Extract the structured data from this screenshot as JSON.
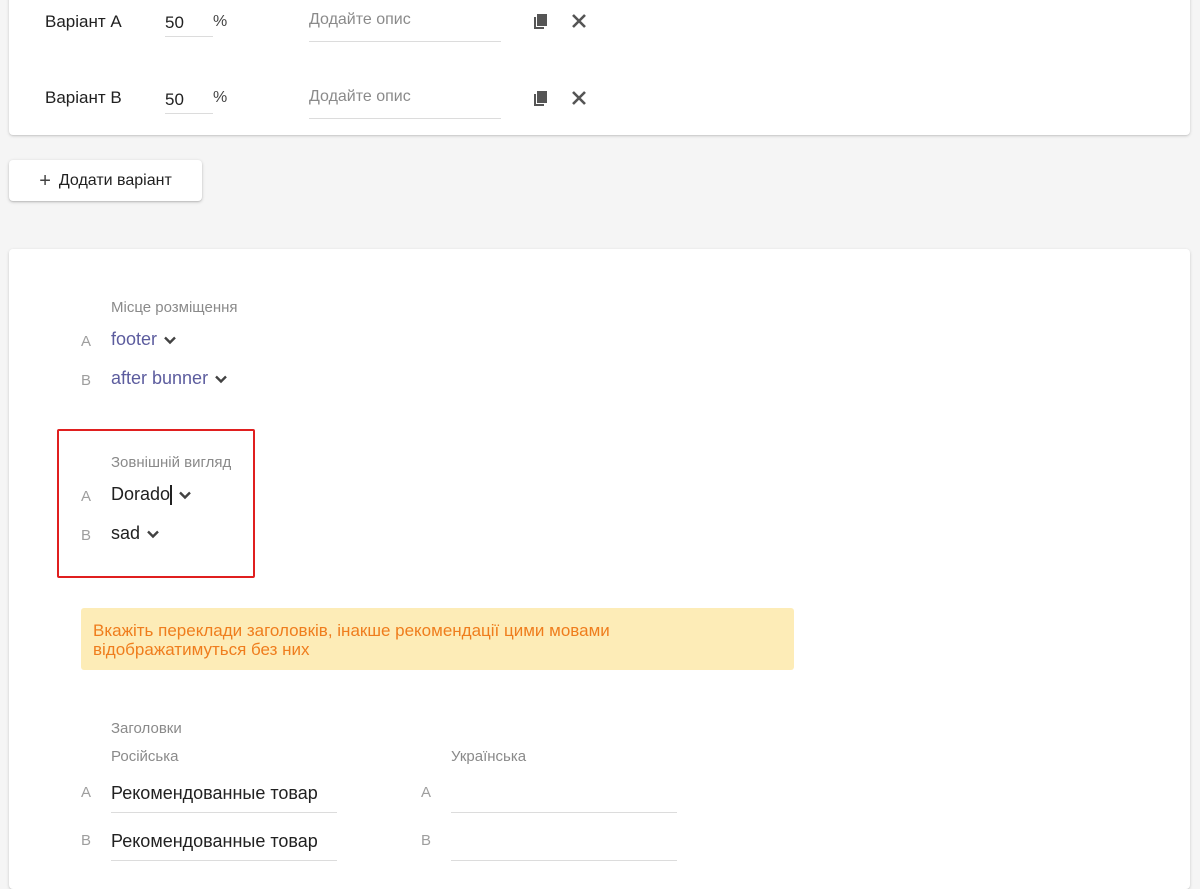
{
  "variants": [
    {
      "name": "Варіант А",
      "percent": "50",
      "percent_sign": "%",
      "description_placeholder": "Додайте опис"
    },
    {
      "name": "Варіант В",
      "percent": "50",
      "percent_sign": "%",
      "description_placeholder": "Додайте опис"
    }
  ],
  "icons": {
    "copy": "copy-icon",
    "remove": "close-icon",
    "add": "plus-icon",
    "dropdown": "chevron-down-icon"
  },
  "add_variant_label": "Додати варіант",
  "placement": {
    "label": "Місце розміщення",
    "rows": [
      {
        "letter": "A",
        "value": "footer"
      },
      {
        "letter": "B",
        "value": "after bunner"
      }
    ]
  },
  "appearance": {
    "label": "Зовнішній вигляд",
    "rows": [
      {
        "letter": "A",
        "value": "Dorado"
      },
      {
        "letter": "B",
        "value": "sad"
      }
    ]
  },
  "notice": {
    "line1": "Вкажіть переклади заголовків, інакше рекомендації цими мовами",
    "line2": "відображатимуться без них"
  },
  "titles": {
    "label": "Заголовки",
    "russian": {
      "label": "Російська",
      "rows": [
        {
          "letter": "A",
          "value": "Рекомендованные товар"
        },
        {
          "letter": "B",
          "value": "Рекомендованные товар"
        }
      ]
    },
    "ukrainian": {
      "label": "Українська",
      "rows": [
        {
          "letter": "A",
          "value": ""
        },
        {
          "letter": "B",
          "value": ""
        }
      ]
    }
  },
  "colors": {
    "accent_link": "#5c5c9e",
    "highlight": "#e01f1f",
    "notice_bg": "#fdecb7",
    "notice_text": "#ef7d1d"
  }
}
